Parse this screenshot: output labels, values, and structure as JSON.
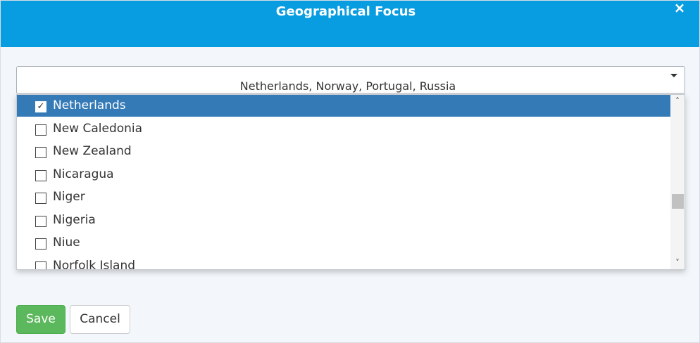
{
  "modal": {
    "title": "Geographical Focus",
    "close_icon": "×"
  },
  "select": {
    "value": "Netherlands, Norway, Portugal, Russia",
    "caret_icon": "caret-down-icon"
  },
  "options": [
    {
      "label": "Netherlands",
      "checked": true,
      "highlighted": true
    },
    {
      "label": "New Caledonia",
      "checked": false,
      "highlighted": false
    },
    {
      "label": "New Zealand",
      "checked": false,
      "highlighted": false
    },
    {
      "label": "Nicaragua",
      "checked": false,
      "highlighted": false
    },
    {
      "label": "Niger",
      "checked": false,
      "highlighted": false
    },
    {
      "label": "Nigeria",
      "checked": false,
      "highlighted": false
    },
    {
      "label": "Niue",
      "checked": false,
      "highlighted": false
    },
    {
      "label": "Norfolk Island",
      "checked": false,
      "highlighted": false
    }
  ],
  "scrollbar": {
    "up_icon": "˄",
    "down_icon": "˅"
  },
  "buttons": {
    "save_label": "Save",
    "cancel_label": "Cancel"
  },
  "colors": {
    "header": "#089de0",
    "highlight": "#337ab7",
    "save": "#5cb85c"
  }
}
